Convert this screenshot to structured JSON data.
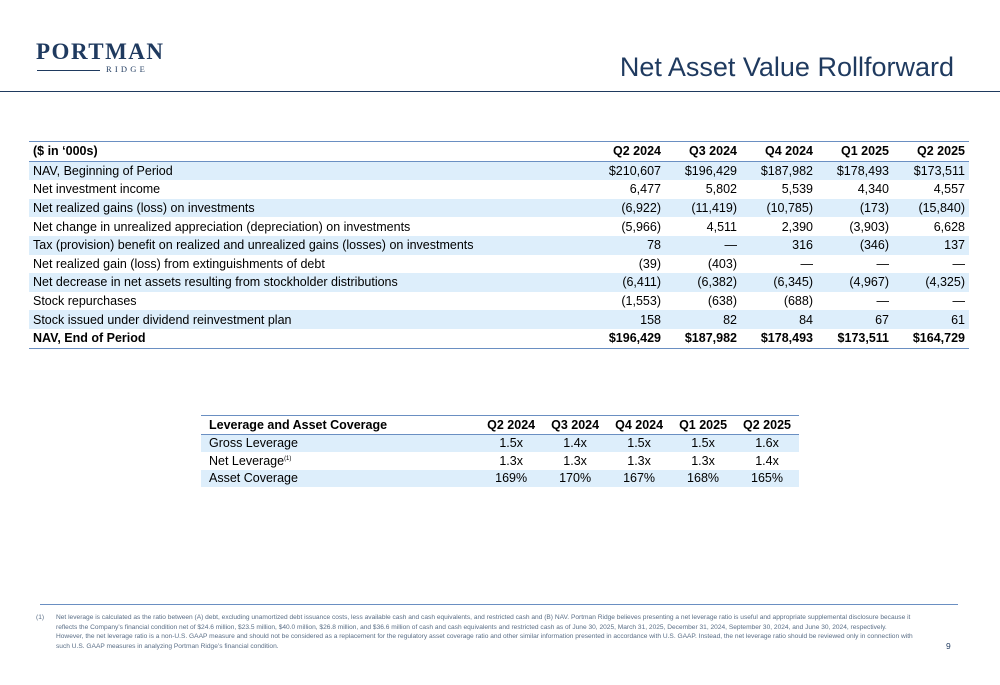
{
  "header": {
    "logo_word": "PORTMAN",
    "logo_sub": "RIDGE",
    "title": "Net Asset Value Rollforward"
  },
  "nav_table": {
    "columns": [
      "($ in ‘000s)",
      "Q2 2024",
      "Q3 2024",
      "Q4 2024",
      "Q1 2025",
      "Q2 2025"
    ],
    "rows": [
      {
        "label": "NAV, Beginning of Period",
        "values": [
          "$210,607",
          "$196,429",
          "$187,982",
          "$178,493",
          "$173,511"
        ]
      },
      {
        "label": "Net investment income",
        "values": [
          "6,477",
          "5,802",
          "5,539",
          "4,340",
          "4,557"
        ]
      },
      {
        "label": "Net realized gains (loss) on investments",
        "values": [
          "(6,922)",
          "(11,419)",
          "(10,785)",
          "(173)",
          "(15,840)"
        ]
      },
      {
        "label": "Net change in unrealized appreciation (depreciation) on investments",
        "values": [
          "(5,966)",
          "4,511",
          "2,390",
          "(3,903)",
          "6,628"
        ]
      },
      {
        "label": "Tax (provision) benefit on realized and unrealized gains (losses) on investments",
        "values": [
          "78",
          "—",
          "316",
          "(346)",
          "137"
        ]
      },
      {
        "label": "Net realized gain (loss) from extinguishments of debt",
        "values": [
          "(39)",
          "(403)",
          "—",
          "—",
          "—"
        ]
      },
      {
        "label": "Net decrease in net assets resulting from stockholder distributions",
        "values": [
          "(6,411)",
          "(6,382)",
          "(6,345)",
          "(4,967)",
          "(4,325)"
        ]
      },
      {
        "label": "Stock repurchases",
        "values": [
          "(1,553)",
          "(638)",
          "(688)",
          "—",
          "—"
        ]
      },
      {
        "label": "Stock issued under dividend reinvestment plan",
        "values": [
          "158",
          "82",
          "84",
          "67",
          "61"
        ]
      },
      {
        "label": "NAV, End of Period",
        "values": [
          "$196,429",
          "$187,982",
          "$178,493",
          "$173,511",
          "$164,729"
        ]
      }
    ]
  },
  "leverage_table": {
    "columns": [
      "Leverage and Asset Coverage",
      "Q2 2024",
      "Q3 2024",
      "Q4 2024",
      "Q1 2025",
      "Q2 2025"
    ],
    "rows": [
      {
        "label": "Gross Leverage",
        "sup": "",
        "values": [
          "1.5x",
          "1.4x",
          "1.5x",
          "1.5x",
          "1.6x"
        ]
      },
      {
        "label": "Net Leverage",
        "sup": "(1)",
        "values": [
          "1.3x",
          "1.3x",
          "1.3x",
          "1.3x",
          "1.4x"
        ]
      },
      {
        "label": "Asset Coverage",
        "sup": "",
        "values": [
          "169%",
          "170%",
          "167%",
          "168%",
          "165%"
        ]
      }
    ]
  },
  "footnote": {
    "number": "(1)",
    "text": "Net leverage is calculated as the ratio between (A) debt, excluding unamortized debt issuance costs, less available cash and cash equivalents, and restricted cash and (B) NAV. Portman Ridge believes presenting a net leverage ratio is useful and appropriate supplemental disclosure because it reflects the Company’s financial condition net of $24.6 million, $23.5 million, $40.0 million, $26.8 million, and $36.6 million of cash and cash equivalents and restricted cash as of June 30, 2025, March 31, 2025, December 31, 2024, September 30, 2024, and June 30, 2024, respectively. However, the net leverage ratio is a non-U.S. GAAP measure and should not be considered as a replacement for the regulatory asset coverage ratio and other similar information presented in accordance with U.S. GAAP. Instead, the net leverage ratio should be reviewed only in connection with such U.S. GAAP measures in analyzing Portman Ridge’s financial condition."
  },
  "page_number": "9"
}
